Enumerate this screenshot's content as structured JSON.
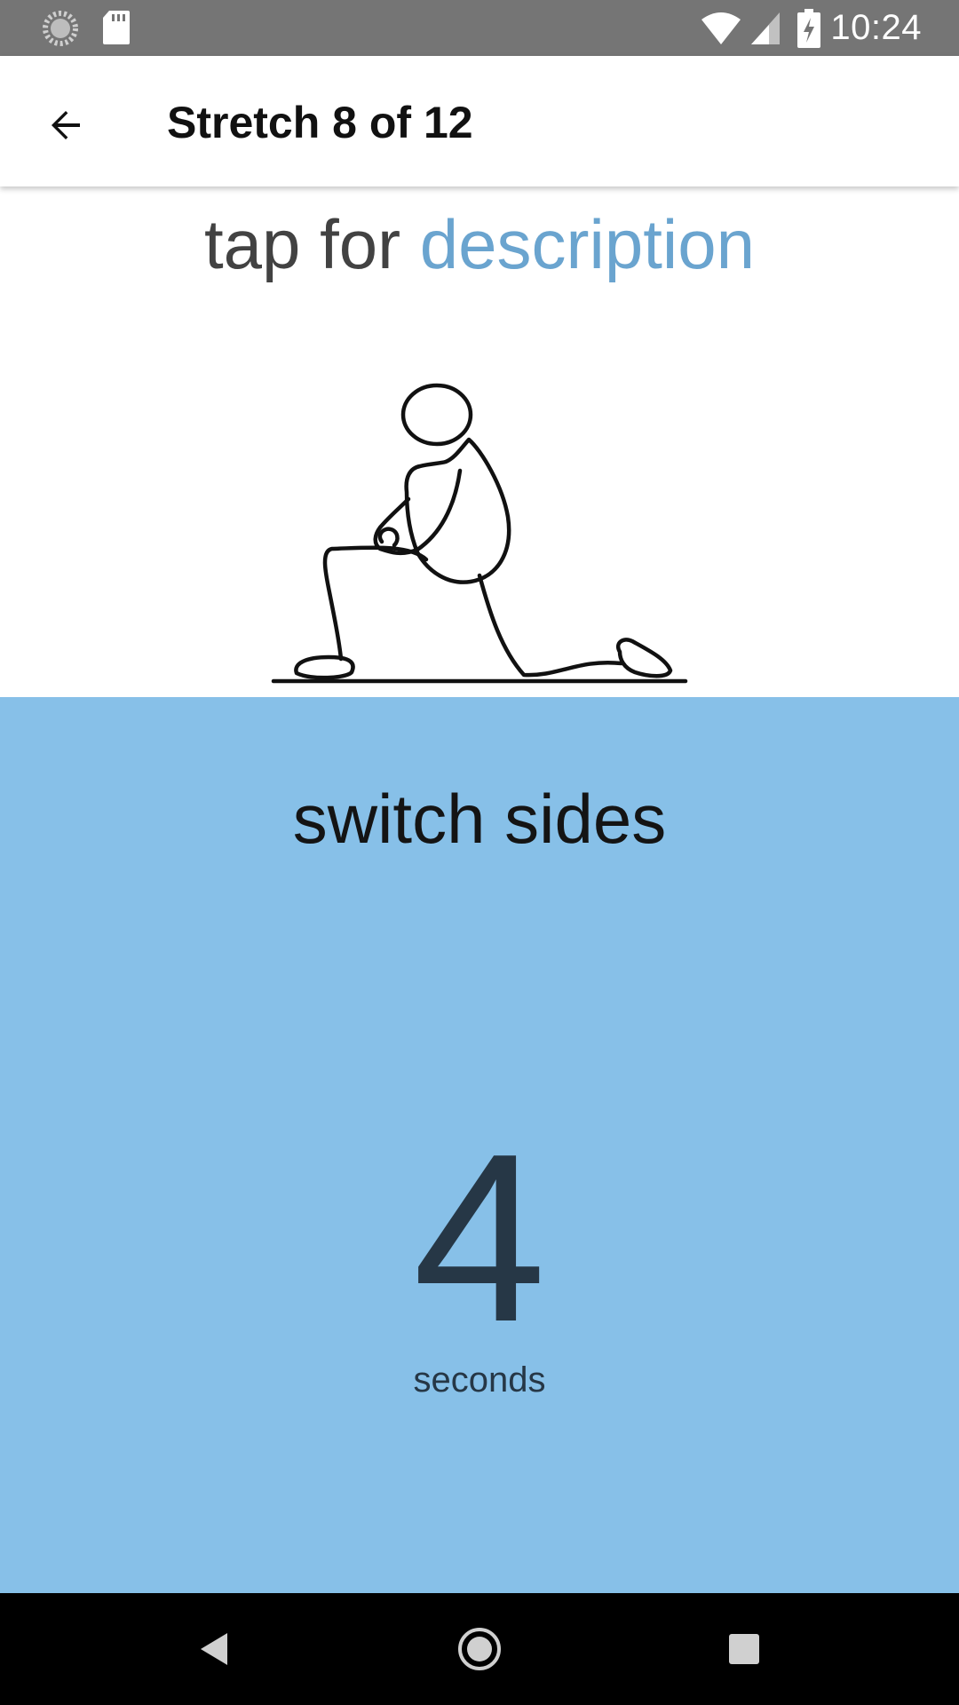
{
  "status_bar": {
    "time": "10:24",
    "icons": [
      "loading-icon",
      "sd-card-icon",
      "wifi-icon",
      "signal-icon",
      "battery-charging-icon"
    ]
  },
  "app_bar": {
    "title": "Stretch 8 of 12",
    "back_icon": "arrow-back-icon"
  },
  "description_prompt": {
    "prefix": "tap for ",
    "link": "description"
  },
  "illustration": {
    "icon": "kneeling-hip-flexor-stretch-figure"
  },
  "timer": {
    "instruction": "switch sides",
    "remaining": "4",
    "unit": "seconds"
  },
  "nav_bar": {
    "icons": [
      "nav-back-icon",
      "nav-home-icon",
      "nav-recents-icon"
    ]
  },
  "colors": {
    "status_bar": "#757575",
    "accent_link": "#6aa4cf",
    "timer_panel": "#87c0e8",
    "countdown_text": "#263746"
  }
}
